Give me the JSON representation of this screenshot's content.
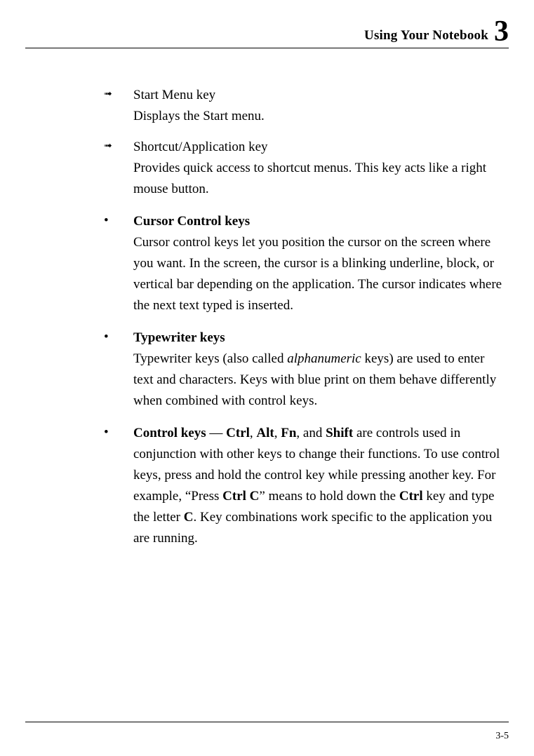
{
  "header": {
    "title": "Using Your Notebook",
    "chapter_number": "3"
  },
  "sub_items": [
    {
      "title": "Start Menu key",
      "description": "Displays the Start menu."
    },
    {
      "title": "Shortcut/Application key",
      "description": "Provides quick access to shortcut menus. This key acts like a right mouse button."
    }
  ],
  "main_items": {
    "cursor": {
      "heading": "Cursor Control keys",
      "body": "Cursor control keys let you position the cursor on the screen where you want. In the screen, the cursor is a blinking underline, block, or vertical bar depending on the application. The cursor indicates where the next text typed is inserted."
    },
    "typewriter": {
      "heading": "Typewriter keys",
      "pre": "Typewriter keys (also called ",
      "italic": "alphanumeric",
      "post": " keys) are used to enter text and characters. Keys with blue print on them behave differently when combined with control keys."
    },
    "control": {
      "heading": "Control keys",
      "dash": " — ",
      "k1": "Ctrl",
      "c1": ", ",
      "k2": "Alt",
      "c2": ", ",
      "k3": "Fn",
      "c3": ", and ",
      "k4": "Shift",
      "seg1": " are controls used in conjunction with other keys to change their functions. To use control keys, press and hold the control key while pressing another key. For example, “Press ",
      "k5": "Ctrl C",
      "seg2": "” means to hold down the ",
      "k6": "Ctrl",
      "seg3": " key and type the letter ",
      "k7": "C",
      "seg4": ". Key combinations work specific to the application you are running."
    }
  },
  "footer": {
    "page_num": "3-5"
  }
}
